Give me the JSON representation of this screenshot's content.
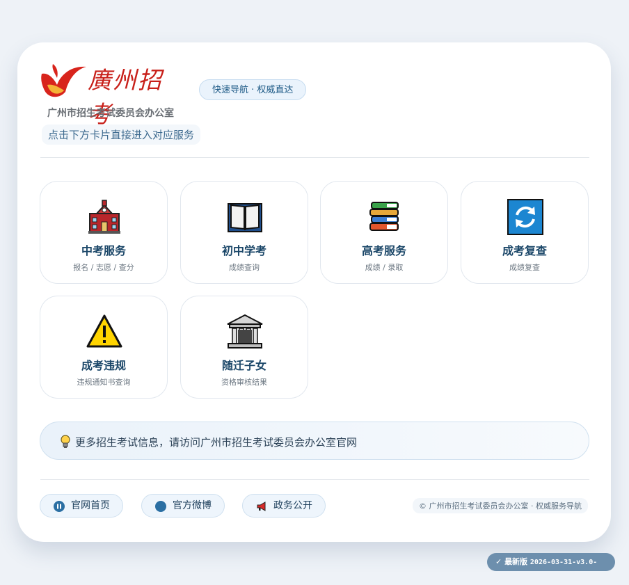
{
  "header": {
    "logo_text": "廣州招考",
    "nav_pill": "快速导航 · 权威直达",
    "org_name": "广州市招生考试委员会办公室",
    "hint": "点击下方卡片直接进入对应服务"
  },
  "tiles": [
    {
      "icon": "school-icon",
      "title": "中考服务",
      "subtitle": "报名 / 志愿 / 查分"
    },
    {
      "icon": "open-book-icon",
      "title": "初中学考",
      "subtitle": "成绩查询"
    },
    {
      "icon": "books-icon",
      "title": "高考服务",
      "subtitle": "成绩 / 录取"
    },
    {
      "icon": "refresh-icon",
      "title": "成考复查",
      "subtitle": "成绩复查"
    },
    {
      "icon": "warning-icon",
      "title": "成考违规",
      "subtitle": "违规通知书查询"
    },
    {
      "icon": "classical-building-icon",
      "title": "随迁子女",
      "subtitle": "资格审核结果"
    }
  ],
  "info": {
    "icon": "lightbulb-icon",
    "text": "更多招生考试信息，请访问广州市招生考试委员会办公室官网"
  },
  "footer": {
    "links": [
      {
        "icon": "pause-circle-icon",
        "label": "官网首页"
      },
      {
        "icon": "blue-circle-icon",
        "label": "官方微博"
      },
      {
        "icon": "megaphone-icon",
        "label": "政务公开"
      }
    ],
    "copyright": "© 广州市招生考试委员会办公室 · 权威服务导航"
  },
  "version": {
    "check": "✓",
    "label": "最新版",
    "value": "2026-03-31-v3.0-"
  },
  "colors": {
    "accent": "#1a4668",
    "brand_red": "#c8201a",
    "background": "#eef2f7"
  }
}
